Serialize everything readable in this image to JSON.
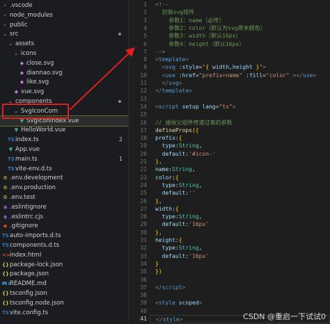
{
  "explorer": {
    "items": [
      {
        "label": ".vscode",
        "type": "folder",
        "open": false,
        "depth": 0
      },
      {
        "label": "node_modules",
        "type": "folder",
        "open": false,
        "depth": 0
      },
      {
        "label": "public",
        "type": "folder",
        "open": false,
        "depth": 0
      },
      {
        "label": "src",
        "type": "folder",
        "open": true,
        "depth": 0,
        "dot": true
      },
      {
        "label": "assets",
        "type": "folder",
        "open": true,
        "depth": 1
      },
      {
        "label": "icons",
        "type": "folder",
        "open": true,
        "depth": 2
      },
      {
        "label": "close.svg",
        "type": "svg",
        "depth": 3
      },
      {
        "label": "diannao.svg",
        "type": "svg",
        "depth": 3
      },
      {
        "label": "like.svg",
        "type": "svg",
        "depth": 3
      },
      {
        "label": "vue.svg",
        "type": "svg",
        "depth": 2
      },
      {
        "label": "components",
        "type": "folder",
        "open": true,
        "depth": 1,
        "dot": true
      },
      {
        "label": "SvgIconCom",
        "type": "folder",
        "open": true,
        "depth": 2
      },
      {
        "label": "SvgIconIndex.vue",
        "type": "vue",
        "depth": 3,
        "active": true
      },
      {
        "label": "HelloWorld.vue",
        "type": "vue",
        "depth": 2
      },
      {
        "label": "index.ts",
        "type": "ts",
        "depth": 1,
        "badge": "2"
      },
      {
        "label": "App.vue",
        "type": "vue",
        "depth": 1
      },
      {
        "label": "main.ts",
        "type": "ts",
        "depth": 1,
        "badge": "1"
      },
      {
        "label": "vite-env.d.ts",
        "type": "ts",
        "depth": 1
      },
      {
        "label": ".env.development",
        "type": "env",
        "depth": 0
      },
      {
        "label": ".env.production",
        "type": "env",
        "depth": 0
      },
      {
        "label": ".env.test",
        "type": "env",
        "depth": 0
      },
      {
        "label": ".eslintignore",
        "type": "lint",
        "depth": 0
      },
      {
        "label": ".eslintrc.cjs",
        "type": "cjs",
        "depth": 0
      },
      {
        "label": ".gitignore",
        "type": "git",
        "depth": 0
      },
      {
        "label": "auto-imports.d.ts",
        "type": "ts",
        "depth": 0
      },
      {
        "label": "components.d.ts",
        "type": "ts",
        "depth": 0
      },
      {
        "label": "index.html",
        "type": "html",
        "depth": 0
      },
      {
        "label": "package-lock.json",
        "type": "json",
        "depth": 0
      },
      {
        "label": "package.json",
        "type": "json",
        "depth": 0
      },
      {
        "label": "README.md",
        "type": "md",
        "depth": 0
      },
      {
        "label": "tsconfig.json",
        "type": "json",
        "depth": 0
      },
      {
        "label": "tsconfig.node.json",
        "type": "json",
        "depth": 0
      },
      {
        "label": "vite.config.ts",
        "type": "ts",
        "depth": 0
      }
    ],
    "icon_glyphs": {
      "svg": "◆",
      "vue": "▼",
      "ts": "TS",
      "env": "⚙",
      "lint": "◉",
      "cjs": "◉",
      "git": "◆",
      "html": "<>",
      "json": "{}",
      "md": "M↓"
    },
    "icon_names": {
      "svg": "svg-file-icon",
      "vue": "vue-file-icon",
      "ts": "typescript-file-icon",
      "env": "env-file-icon",
      "lint": "eslint-file-icon",
      "cjs": "eslint-config-icon",
      "git": "git-file-icon",
      "html": "html-file-icon",
      "json": "json-file-icon",
      "md": "markdown-file-icon"
    }
  },
  "editor": {
    "current_line": 41,
    "lines": [
      [
        [
          "c-comment",
          "<!--"
        ]
      ],
      [
        [
          "c-comment",
          "  封装svg组件"
        ]
      ],
      [
        [
          "c-comment",
          "    参数1：name（必传）"
        ]
      ],
      [
        [
          "c-comment",
          "    参数2：color（默认为svg原本颜色）"
        ]
      ],
      [
        [
          "c-comment",
          "    参数3：width（默认16px）"
        ]
      ],
      [
        [
          "c-comment",
          "    参数4：height（默认16px）"
        ]
      ],
      [
        [
          "c-comment",
          "-->"
        ]
      ],
      [
        [
          "c-punct",
          "<"
        ],
        [
          "c-kw",
          "template"
        ],
        [
          "c-punct",
          ">"
        ]
      ],
      [
        [
          "c-def",
          "  "
        ],
        [
          "c-punct",
          "<"
        ],
        [
          "c-kw",
          "svg"
        ],
        [
          "c-def",
          " "
        ],
        [
          "c-attr",
          ":style"
        ],
        [
          "c-def",
          "="
        ],
        [
          "c-str",
          "\""
        ],
        [
          "c-brace",
          "{"
        ],
        [
          "c-key",
          " width"
        ],
        [
          "c-def",
          ","
        ],
        [
          "c-key",
          "height "
        ],
        [
          "c-brace",
          "}"
        ],
        [
          "c-str",
          "\""
        ],
        [
          "c-punct",
          ">"
        ]
      ],
      [
        [
          "c-def",
          "  "
        ],
        [
          "c-punct",
          "<"
        ],
        [
          "c-kw",
          "use"
        ],
        [
          "c-def",
          " "
        ],
        [
          "c-attr",
          ":href"
        ],
        [
          "c-def",
          "="
        ],
        [
          "c-str",
          "\"prefix+name\""
        ],
        [
          "c-def",
          " "
        ],
        [
          "c-attr",
          ":fill"
        ],
        [
          "c-def",
          "="
        ],
        [
          "c-str",
          "\"color\""
        ],
        [
          "c-def",
          " "
        ],
        [
          "c-punct",
          "></"
        ],
        [
          "c-kw",
          "use"
        ],
        [
          "c-punct",
          ">"
        ]
      ],
      [
        [
          "c-def",
          "  "
        ],
        [
          "c-punct",
          "</"
        ],
        [
          "c-kw",
          "svg"
        ],
        [
          "c-punct",
          ">"
        ]
      ],
      [
        [
          "c-punct",
          "</"
        ],
        [
          "c-kw",
          "template"
        ],
        [
          "c-punct",
          ">"
        ]
      ],
      [],
      [
        [
          "c-punct",
          "<"
        ],
        [
          "c-kw",
          "script"
        ],
        [
          "c-def",
          " "
        ],
        [
          "c-attr",
          "setup"
        ],
        [
          "c-def",
          " "
        ],
        [
          "c-attr",
          "lang"
        ],
        [
          "c-def",
          "="
        ],
        [
          "c-str",
          "\"ts\""
        ],
        [
          "c-punct",
          ">"
        ]
      ],
      [],
      [
        [
          "c-comment",
          "// 接收父组件传递过来的参数"
        ]
      ],
      [
        [
          "c-fn",
          "defineProps"
        ],
        [
          "c-brace",
          "({"
        ]
      ],
      [
        [
          "c-key",
          "prefix"
        ],
        [
          "c-def",
          ":"
        ],
        [
          "c-brace",
          "{"
        ]
      ],
      [
        [
          "c-def",
          "  "
        ],
        [
          "c-key",
          "type"
        ],
        [
          "c-def",
          ":"
        ],
        [
          "c-type",
          "String"
        ],
        [
          "c-def",
          ","
        ]
      ],
      [
        [
          "c-def",
          "  "
        ],
        [
          "c-key",
          "default"
        ],
        [
          "c-def",
          ":"
        ],
        [
          "c-str",
          "'#icon-'"
        ]
      ],
      [
        [
          "c-brace",
          "}"
        ],
        [
          "c-def",
          ","
        ]
      ],
      [
        [
          "c-key",
          "name"
        ],
        [
          "c-def",
          ":"
        ],
        [
          "c-type",
          "String"
        ],
        [
          "c-def",
          ","
        ]
      ],
      [
        [
          "c-key",
          "color"
        ],
        [
          "c-def",
          ":"
        ],
        [
          "c-brace",
          "{"
        ]
      ],
      [
        [
          "c-def",
          "  "
        ],
        [
          "c-key",
          "type"
        ],
        [
          "c-def",
          ":"
        ],
        [
          "c-type",
          "String"
        ],
        [
          "c-def",
          ","
        ]
      ],
      [
        [
          "c-def",
          "  "
        ],
        [
          "c-key",
          "default"
        ],
        [
          "c-def",
          ":"
        ],
        [
          "c-str",
          "''"
        ]
      ],
      [
        [
          "c-brace",
          "}"
        ],
        [
          "c-def",
          ","
        ]
      ],
      [
        [
          "c-key",
          "width"
        ],
        [
          "c-def",
          ":"
        ],
        [
          "c-brace",
          "{"
        ]
      ],
      [
        [
          "c-def",
          "  "
        ],
        [
          "c-key",
          "type"
        ],
        [
          "c-def",
          ":"
        ],
        [
          "c-type",
          "String"
        ],
        [
          "c-def",
          ","
        ]
      ],
      [
        [
          "c-def",
          "  "
        ],
        [
          "c-key",
          "default"
        ],
        [
          "c-def",
          ":"
        ],
        [
          "c-str",
          "'16px'"
        ]
      ],
      [
        [
          "c-brace",
          "}"
        ],
        [
          "c-def",
          ","
        ]
      ],
      [
        [
          "c-key",
          "height"
        ],
        [
          "c-def",
          ":"
        ],
        [
          "c-brace",
          "{"
        ]
      ],
      [
        [
          "c-def",
          "  "
        ],
        [
          "c-key",
          "type"
        ],
        [
          "c-def",
          ":"
        ],
        [
          "c-type",
          "String"
        ],
        [
          "c-def",
          ","
        ]
      ],
      [
        [
          "c-def",
          "  "
        ],
        [
          "c-key",
          "default"
        ],
        [
          "c-def",
          ":"
        ],
        [
          "c-str",
          "'16px'"
        ]
      ],
      [
        [
          "c-brace",
          "}"
        ]
      ],
      [
        [
          "c-brace",
          "})"
        ]
      ],
      [],
      [
        [
          "c-punct",
          "</"
        ],
        [
          "c-kw",
          "script"
        ],
        [
          "c-punct",
          ">"
        ]
      ],
      [],
      [
        [
          "c-punct",
          "<"
        ],
        [
          "c-kw",
          "style"
        ],
        [
          "c-def",
          " "
        ],
        [
          "c-attr",
          "scoped"
        ],
        [
          "c-punct",
          ">"
        ]
      ],
      [],
      [
        [
          "c-punct",
          "</"
        ],
        [
          "c-kw",
          "style"
        ],
        [
          "c-punct",
          ">"
        ]
      ]
    ]
  },
  "watermark": "CSDN @重启一下试试0"
}
